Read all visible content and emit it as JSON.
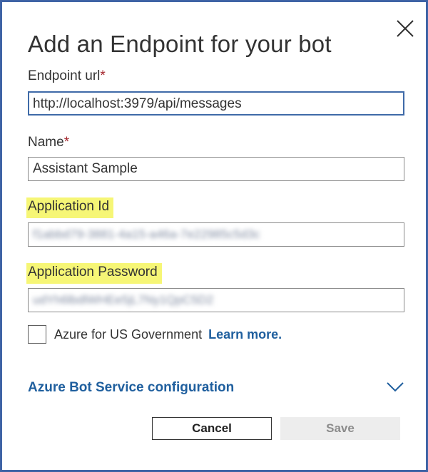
{
  "dialog": {
    "title": "Add an Endpoint for your bot"
  },
  "fields": {
    "endpoint_url": {
      "label": "Endpoint url",
      "required_mark": "*",
      "value": "http://localhost:3979/api/messages"
    },
    "name": {
      "label": "Name",
      "required_mark": "*",
      "value": "Assistant Sample"
    },
    "application_id": {
      "label": "Application Id",
      "value": "f1abbd79-3881-4a15-a46a-7e22985c5d3c"
    },
    "application_password": {
      "label": "Application Password",
      "value": "udYh6lbdlWHEe5jL7Ny1QpC5D2"
    }
  },
  "azure_gov": {
    "label": "Azure for US Government",
    "link_text": "Learn more.",
    "checked": false
  },
  "azure_bot_service": {
    "label": "Azure Bot Service configuration",
    "expanded": false
  },
  "buttons": {
    "cancel": "Cancel",
    "save": "Save"
  },
  "colors": {
    "accent": "#1f5f9e",
    "border": "#3f63a5",
    "highlight": "#f6f676",
    "required": "#a4262c"
  },
  "icons": {
    "close": "close-icon",
    "expand": "chevron-down-icon"
  }
}
